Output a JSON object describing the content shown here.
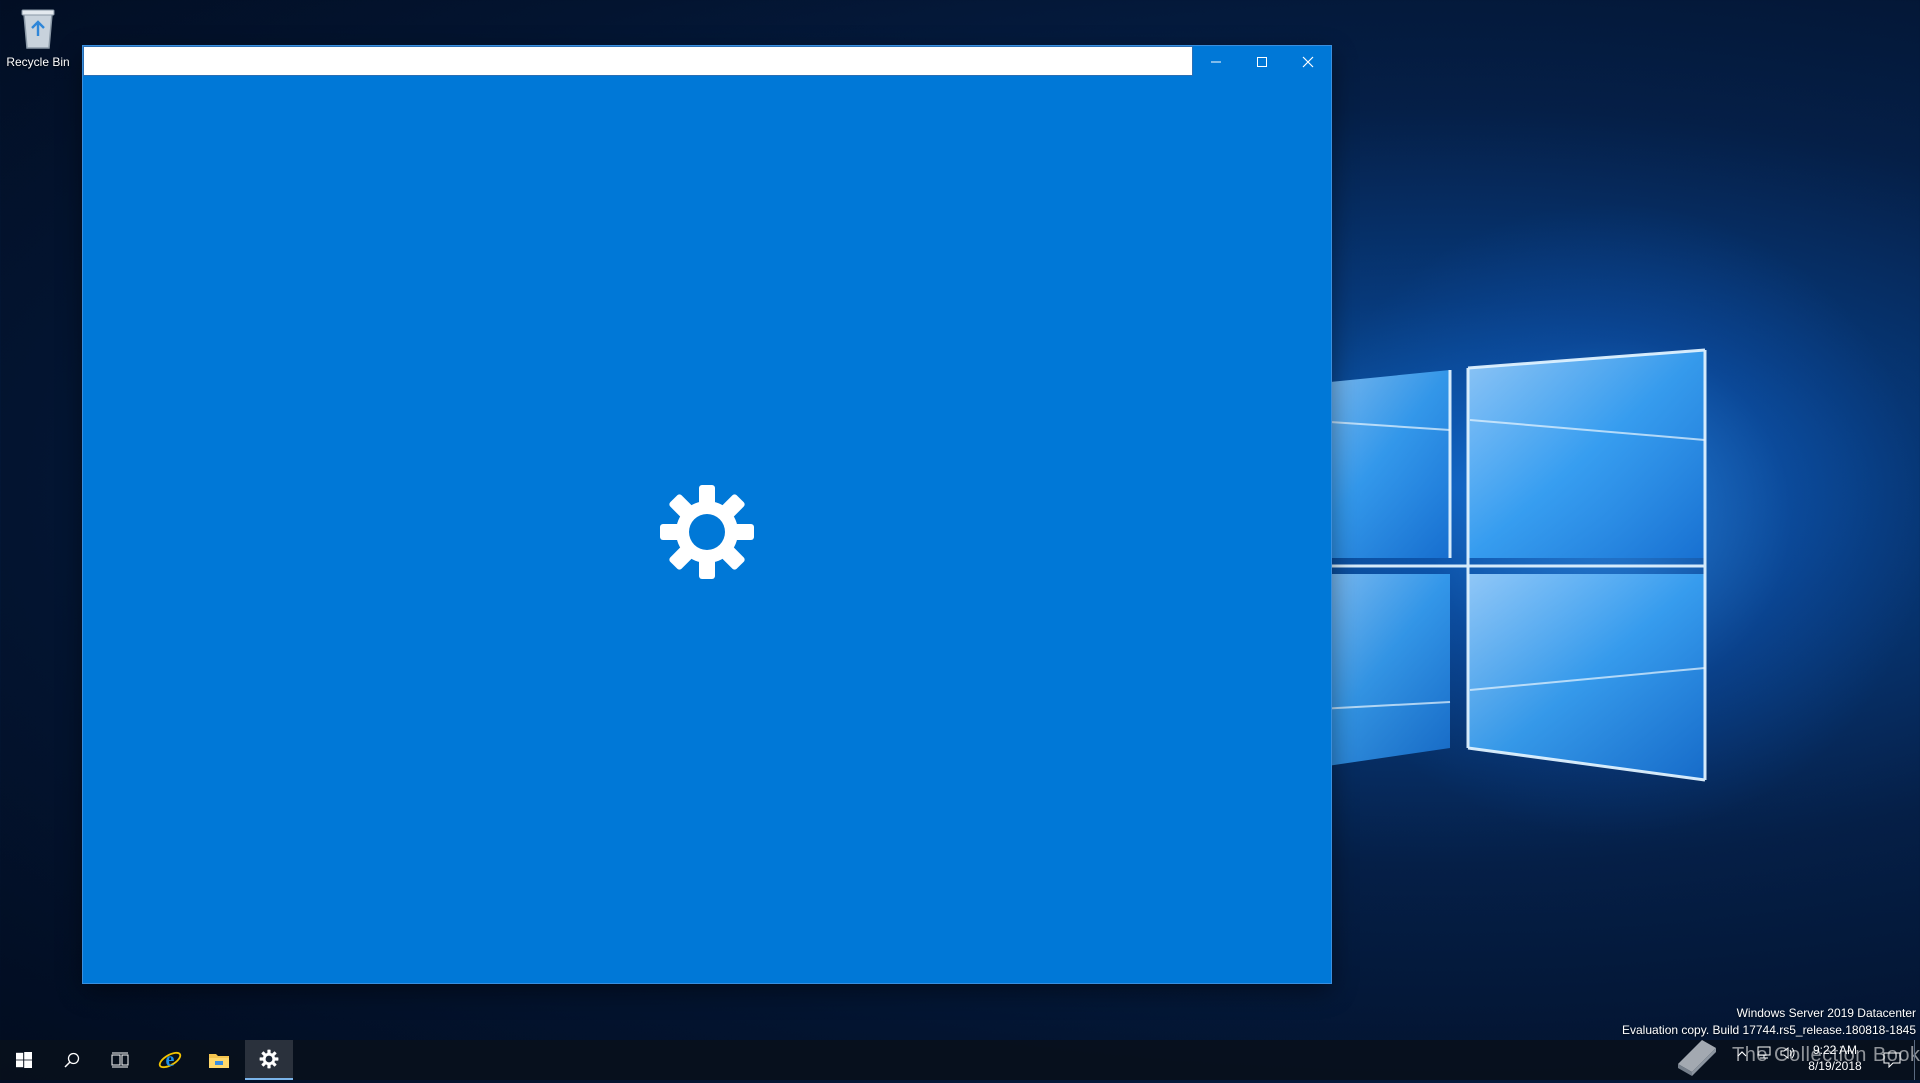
{
  "desktop": {
    "recycle_bin_label": "Recycle Bin",
    "icons": {
      "recycle_bin": "recycle-bin-icon",
      "wallpaper_logo": "windows-logo-icon"
    }
  },
  "window": {
    "title": "",
    "controls": {
      "minimize": "minimize-icon",
      "maximize": "maximize-icon",
      "close": "close-icon"
    },
    "splash_icon": "gear-icon",
    "background_color": "#0078d7"
  },
  "taskbar": {
    "pinned": [
      "windows-start-icon",
      "search-icon",
      "task-view-icon",
      "internet-explorer-icon",
      "file-explorer-icon",
      "settings-gear-icon"
    ],
    "active": "settings-gear-icon"
  },
  "system": {
    "edition": "Windows Server 2019 Datacenter",
    "build": "Evaluation copy. Build 17744.rs5_release.180818-1845",
    "time": "9:22 AM",
    "date": "8/19/2018",
    "watermark_text": "The Collection Book"
  }
}
